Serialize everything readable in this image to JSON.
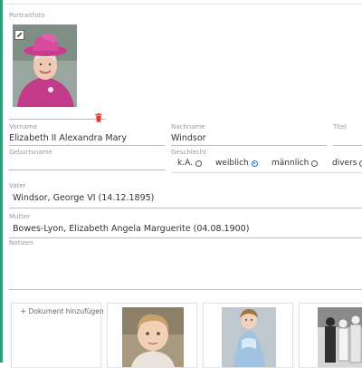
{
  "photo": {
    "label": "Portraitfoto",
    "edit_icon": "edit-icon",
    "delete_icon": "trash-icon",
    "delete_color": "#e53935"
  },
  "fields": {
    "vorname": {
      "label": "Vorname",
      "value": "Elizabeth II Alexandra Mary"
    },
    "nachname": {
      "label": "Nachname",
      "value": "Windsor"
    },
    "titel": {
      "label": "Titel",
      "value": ""
    },
    "geburtsname": {
      "label": "Geburtsname",
      "value": ""
    },
    "geschlecht": {
      "label": "Geschlecht",
      "options": [
        {
          "label": "k.A.",
          "checked": false
        },
        {
          "label": "weiblich",
          "checked": true
        },
        {
          "label": "männlich",
          "checked": false
        },
        {
          "label": "divers",
          "checked": false
        }
      ]
    },
    "vater": {
      "label": "Vater",
      "value": "Windsor, George VI (14.12.1895)"
    },
    "mutter": {
      "label": "Mutter",
      "value": "Bowes-Lyon, Elizabeth Angela Marguerite (04.08.1900)"
    },
    "notizen": {
      "label": "Notizen",
      "value": ""
    }
  },
  "documents": {
    "add_label": "Dokument hinzufügen",
    "add_icon": "plus-icon"
  },
  "colors": {
    "accent": "#2f9e7b",
    "radio_selected": "#1a73e8"
  }
}
